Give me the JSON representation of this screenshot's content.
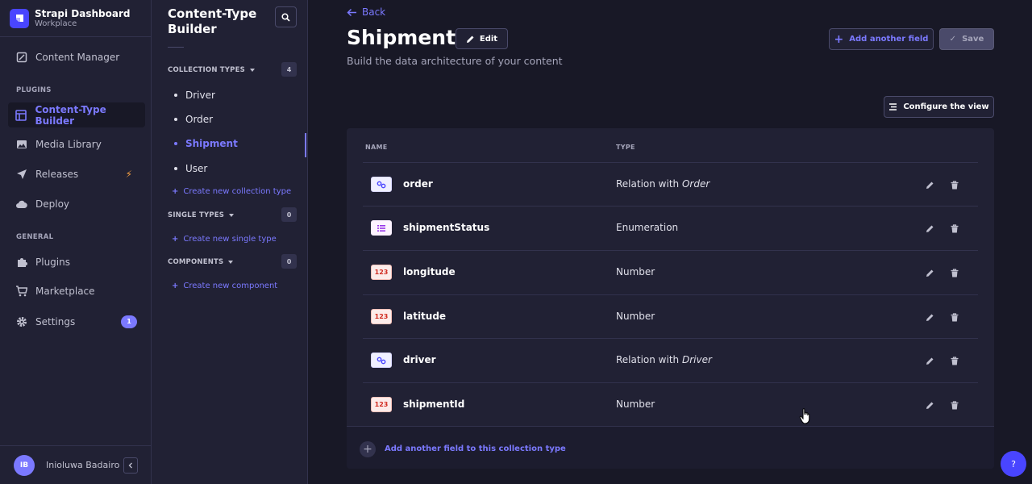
{
  "brand": {
    "title": "Strapi Dashboard",
    "subtitle": "Workplace"
  },
  "mainnav": {
    "content_manager": "Content Manager",
    "plugins_section": "PLUGINS",
    "content_type_builder": "Content-Type Builder",
    "media_library": "Media Library",
    "releases": "Releases",
    "deploy": "Deploy",
    "general_section": "GENERAL",
    "plugins": "Plugins",
    "marketplace": "Marketplace",
    "settings": "Settings",
    "settings_badge": "1"
  },
  "user": {
    "initials": "IB",
    "name": "Inioluwa Badairo"
  },
  "subnav": {
    "title": "Content-Type Builder",
    "collection_types": {
      "label": "COLLECTION TYPES",
      "count": "4",
      "items": [
        "Driver",
        "Order",
        "Shipment",
        "User"
      ],
      "create": "Create new collection type"
    },
    "single_types": {
      "label": "SINGLE TYPES",
      "count": "0",
      "create": "Create new single type"
    },
    "components": {
      "label": "COMPONENTS",
      "count": "0",
      "create": "Create new component"
    }
  },
  "header": {
    "back": "Back",
    "title": "Shipment",
    "edit": "Edit",
    "subtitle": "Build the data architecture of your content",
    "add_field": "Add another field",
    "save": "Save",
    "configure": "Configure the view"
  },
  "table": {
    "col_name": "NAME",
    "col_type": "TYPE",
    "rows": [
      {
        "icon": "relation-icon",
        "name": "order",
        "type": "Relation with ",
        "target": "Order"
      },
      {
        "icon": "enumeration-icon",
        "name": "shipmentStatus",
        "type": "Enumeration",
        "target": ""
      },
      {
        "icon": "number-icon",
        "icon_text": "123",
        "name": "longitude",
        "type": "Number",
        "target": ""
      },
      {
        "icon": "number-icon",
        "icon_text": "123",
        "name": "latitude",
        "type": "Number",
        "target": ""
      },
      {
        "icon": "relation-icon",
        "name": "driver",
        "type": "Relation with ",
        "target": "Driver"
      },
      {
        "icon": "number-icon",
        "icon_text": "123",
        "name": "shipmentId",
        "type": "Number",
        "target": ""
      }
    ],
    "footer_add": "Add another field to this collection type"
  },
  "help": "?",
  "colors": {
    "accent": "#7b79ff",
    "primary": "#4945ff",
    "background": "#181826",
    "panel": "#212134"
  }
}
